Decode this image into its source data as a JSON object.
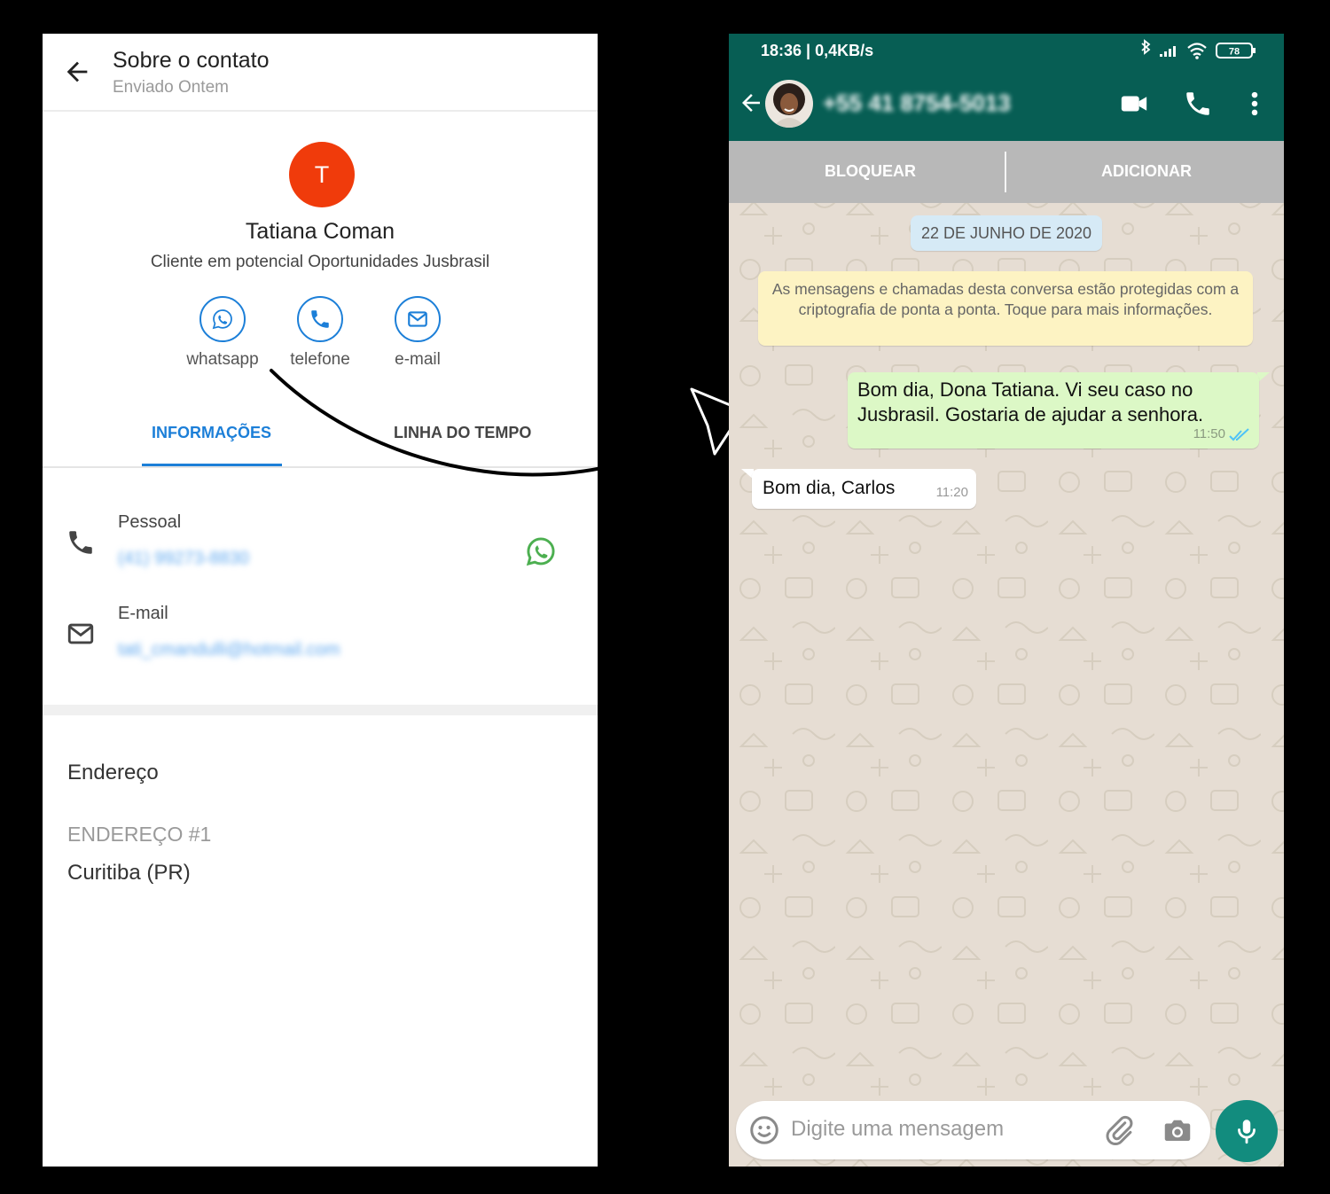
{
  "contact_panel": {
    "header": {
      "title": "Sobre o contato",
      "subtitle": "Enviado Ontem"
    },
    "avatar_initial": "T",
    "name": "Tatiana Coman",
    "tags": "Cliente em potencial  Oportunidades Jusbrasil",
    "actions": [
      {
        "label": "whatsapp",
        "icon": "whatsapp-icon"
      },
      {
        "label": "telefone",
        "icon": "phone-icon"
      },
      {
        "label": "e-mail",
        "icon": "mail-icon"
      }
    ],
    "tabs": [
      {
        "label": "INFORMAÇÕES",
        "active": true
      },
      {
        "label": "LINHA DO TEMPO",
        "active": false
      }
    ],
    "fields": [
      {
        "label": "Pessoal",
        "value": "(41) 99273-8830",
        "icon": "phone-icon"
      },
      {
        "label": "E-mail",
        "value": "tati_cmandulli@hotmail.com",
        "icon": "mail-icon"
      }
    ],
    "address": {
      "heading": "Endereço",
      "label": "ENDEREÇO #1",
      "value": "Curitiba (PR)"
    },
    "colors": {
      "accent": "#1c7fd8",
      "avatar": "#f03b0b",
      "whatsapp": "#4caf50"
    }
  },
  "whatsapp": {
    "status_bar": {
      "time": "18:36 | 0,4KB/s",
      "battery": "78"
    },
    "header": {
      "number": "+55 41 8754-5013"
    },
    "action_bar": {
      "block": "BLOQUEAR",
      "add": "ADICIONAR"
    },
    "date_chip": "22 DE JUNHO DE 2020",
    "encryption_note": "As mensagens e chamadas desta conversa estão protegidas com a criptografia de ponta a ponta. Toque para mais informações.",
    "messages": [
      {
        "direction": "out",
        "text": "Bom dia, Dona Tatiana. Vi seu caso no Jusbrasil. Gostaria de ajudar a senhora.",
        "time": "11:50",
        "read": true
      },
      {
        "direction": "in",
        "text": "Bom dia, Carlos",
        "time": "11:20"
      }
    ],
    "input": {
      "placeholder": "Digite uma mensagem"
    },
    "colors": {
      "header": "#075e54",
      "outgoing": "#dcf8c6",
      "send_button": "#128c7e"
    }
  }
}
